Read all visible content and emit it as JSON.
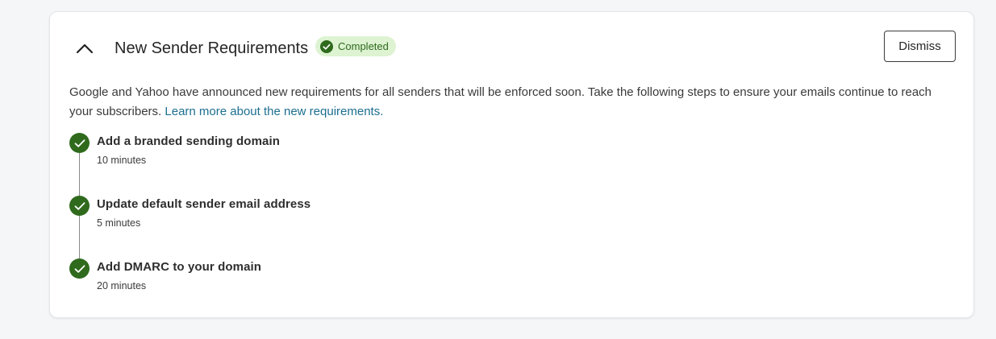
{
  "card": {
    "title": "New Sender Requirements",
    "status_badge": "Completed",
    "dismiss_label": "Dismiss",
    "description_text": "Google and Yahoo have announced new requirements for all senders that will be enforced soon. Take the following steps to ensure your emails continue to reach your subscribers.",
    "description_link": "Learn more about the new requirements.",
    "collapse_icon": "chevron-up-icon"
  },
  "steps": [
    {
      "title": "Add a branded sending domain",
      "time": "10 minutes",
      "status": "completed"
    },
    {
      "title": "Update default sender email address",
      "time": "5 minutes",
      "status": "completed"
    },
    {
      "title": "Add DMARC to your domain",
      "time": "20 minutes",
      "status": "completed"
    }
  ],
  "colors": {
    "success": "#2f6a1d",
    "badge_bg": "#ddf3d2",
    "link": "#1d6f91"
  }
}
